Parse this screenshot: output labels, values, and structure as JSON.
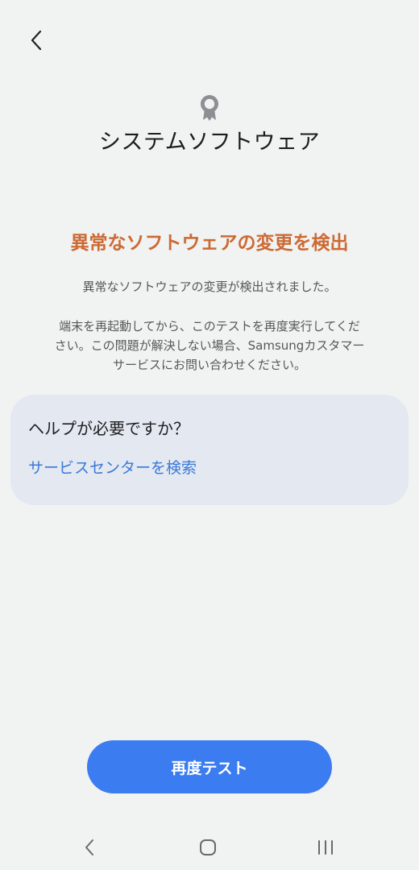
{
  "header": {
    "back_icon": "chevron-left-icon",
    "badge_icon": "award-ribbon-icon",
    "title": "システムソフトウェア"
  },
  "status": {
    "title": "異常なソフトウェアの変更を検出",
    "color": "#cc6a34",
    "message": "異常なソフトウェアの変更が検出されました。",
    "instructions": "端末を再起動してから、このテストを再度実行してくだ\nさい。この問題が解決しない場合、Samsungカスタマー\nサービスにお問い合わせください。"
  },
  "help": {
    "title": "ヘルプが必要ですか？",
    "link_label": "サービスセンターを検索",
    "link_color": "#3b79d8",
    "card_color": "#e3e8f1"
  },
  "actions": {
    "retest_label": "再度テスト",
    "retest_color": "#3b7df0"
  },
  "navbar": {
    "back_icon": "nav-back-icon",
    "home_icon": "nav-home-icon",
    "recents_icon": "nav-recents-icon"
  }
}
